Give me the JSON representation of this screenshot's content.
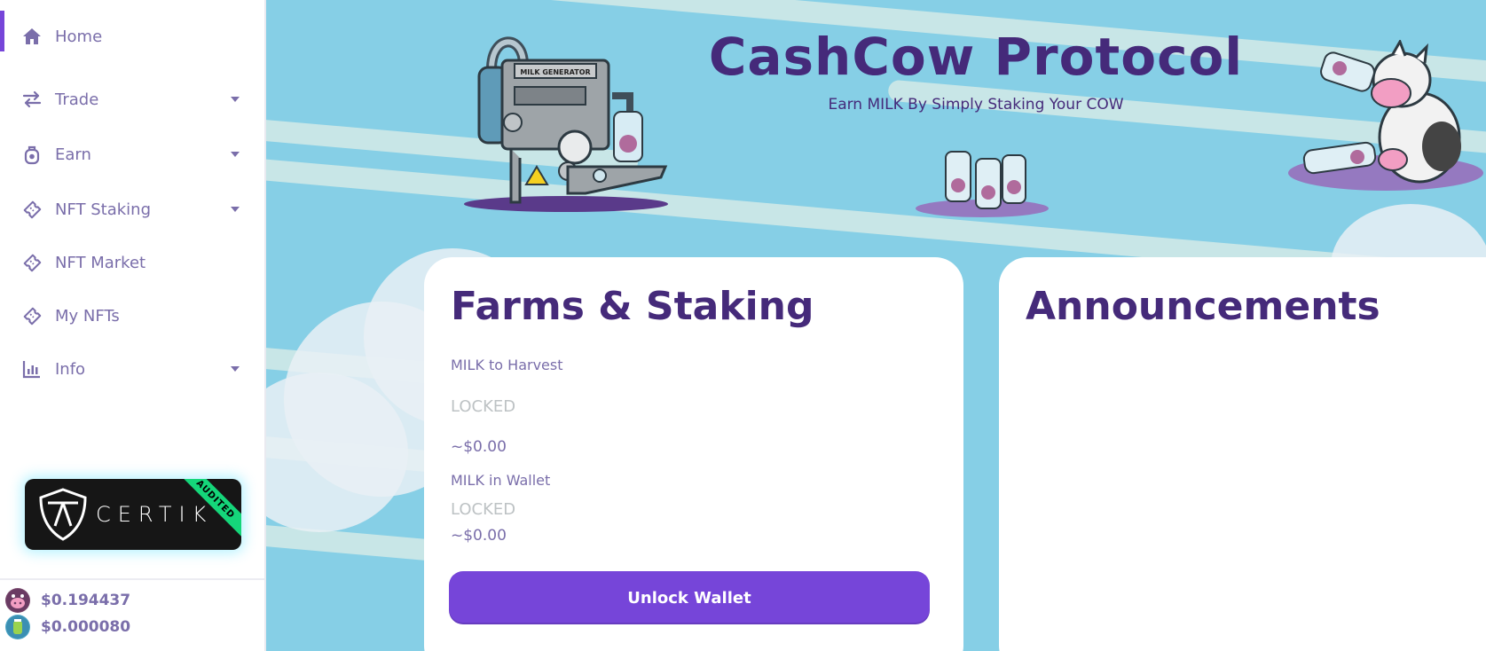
{
  "sidebar": {
    "items": [
      {
        "label": "Home",
        "icon": "home-icon"
      },
      {
        "label": "Trade",
        "icon": "trade-icon"
      },
      {
        "label": "Earn",
        "icon": "earn-icon"
      },
      {
        "label": "NFT Staking",
        "icon": "ticket-icon"
      },
      {
        "label": "NFT Market",
        "icon": "ticket-icon"
      },
      {
        "label": "My NFTs",
        "icon": "ticket-icon"
      },
      {
        "label": "Info",
        "icon": "chart-icon"
      }
    ],
    "certik": {
      "word": "CERTIK",
      "ribbon": "AUDITED"
    },
    "prices": [
      {
        "value": "$0.194437",
        "icon": "cow-token-icon"
      },
      {
        "value": "$0.000080",
        "icon": "milk-token-icon"
      }
    ]
  },
  "hero": {
    "title": "CashCow Protocol",
    "subtitle": "Earn MILK By Simply Staking Your COW",
    "machine_label": "MILK GENERATOR"
  },
  "farms": {
    "title": "Farms & Staking",
    "harvest_label": "MILK to Harvest",
    "harvest_value": "LOCKED",
    "harvest_usd": "~$0.00",
    "wallet_label": "MILK in Wallet",
    "wallet_value": "LOCKED",
    "wallet_usd": "~$0.00",
    "button": "Unlock Wallet"
  },
  "announcements": {
    "title": "Announcements"
  },
  "colors": {
    "primary": "#7645d9",
    "text": "#7a6eaa",
    "heading": "#452a7a",
    "sky": "#86cfe6",
    "locked": "#bdc2c4"
  }
}
